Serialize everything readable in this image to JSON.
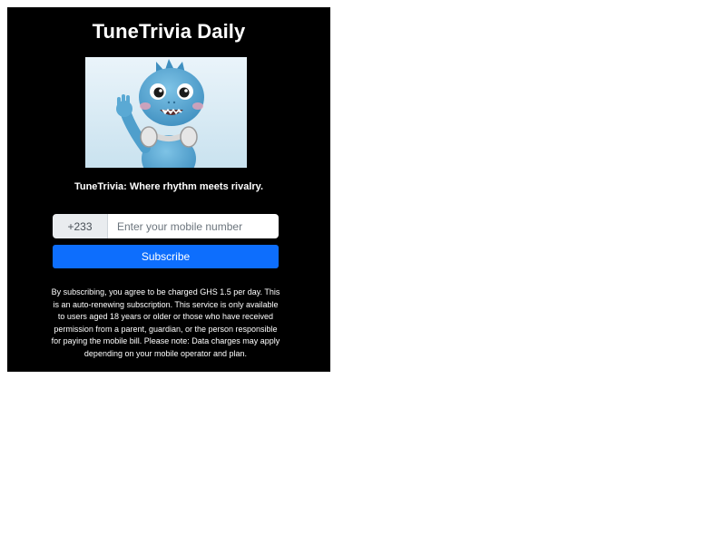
{
  "page": {
    "title": "TuneTrivia Daily",
    "tagline": "TuneTrivia: Where rhythm meets rivalry."
  },
  "mascot": {
    "icon": "cartoon-dragon-headphones-waving"
  },
  "form": {
    "country_code": "+233",
    "phone_placeholder": "Enter your mobile number",
    "phone_value": "",
    "subscribe_label": "Subscribe"
  },
  "disclaimer": "By subscribing, you agree to be charged GHS 1.5 per day. This is an auto-renewing subscription. This service is only available to users aged 18 years or older or those who have received permission from a parent, guardian, or the person responsible for paying the mobile bill. Please note: Data charges may apply depending on your mobile operator and plan.",
  "colors": {
    "background": "#000000",
    "accent": "#0d6efd",
    "text": "#ffffff"
  }
}
